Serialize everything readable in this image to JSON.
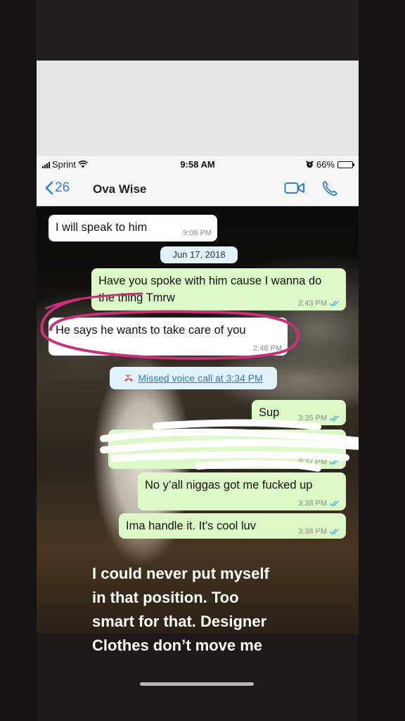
{
  "status_bar": {
    "carrier": "Sprint",
    "time": "9:58 AM",
    "battery": "66%",
    "battery_level": 0.66
  },
  "header": {
    "back_count": "26",
    "contact_name": "Ova Wise"
  },
  "messages": [
    {
      "text": "I will speak to him",
      "time": "9:08 PM"
    },
    {
      "text": "Jun 17, 2018"
    },
    {
      "text": "Have you spoke with him cause I wanna do the thing Tmrw",
      "time": "2:43 PM"
    },
    {
      "text": "He says he wants to take care of you",
      "time": "2:48 PM"
    },
    {
      "text": "Missed voice call at 3:34 PM"
    },
    {
      "text": "Sup",
      "time": "3:35 PM"
    },
    {
      "text": "",
      "time": "3:37 PM"
    },
    {
      "text": "No y’all niggas got me fucked up",
      "time": "3:38 PM"
    },
    {
      "text": "Ima handle it. It’s cool luv",
      "time": "3:38 PM"
    }
  ],
  "colors": {
    "incoming": "#ffffff",
    "outgoing": "#dcf8c6",
    "system": "#e1f2fb",
    "accent": "#2f7de1",
    "highlight_circle": "#c8317a",
    "read_ticks": "#4fb6ec"
  },
  "caption": {
    "lines": [
      "I could never put myself",
      "in that position. Too",
      "smart for that. Designer",
      "Clothes don’t move me"
    ]
  }
}
